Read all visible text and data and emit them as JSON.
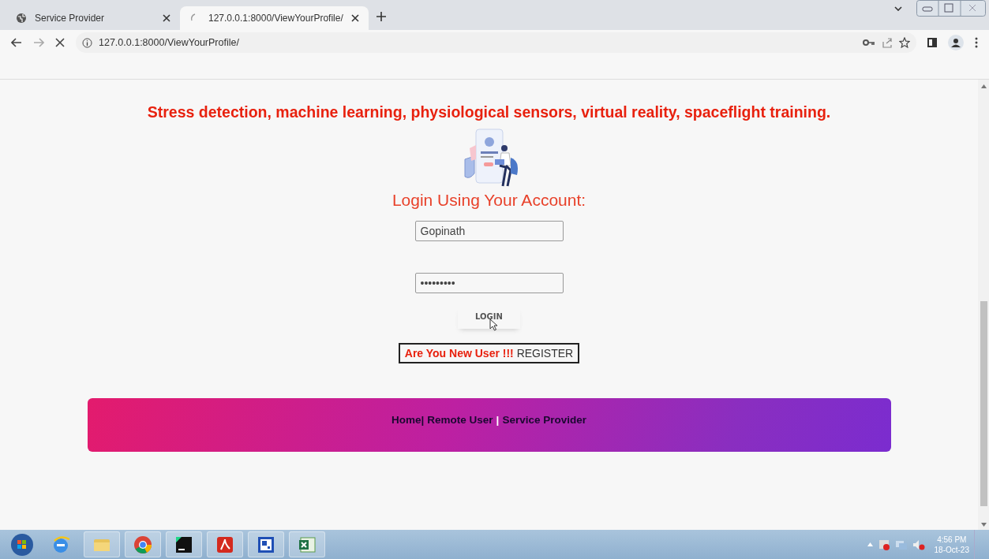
{
  "browser": {
    "tabs": [
      {
        "title": "Service Provider",
        "selected": false,
        "loading": false
      },
      {
        "title": "127.0.0.1:8000/ViewYourProfile/",
        "selected": true,
        "loading": true
      }
    ],
    "address": "127.0.0.1:8000/ViewYourProfile/"
  },
  "page": {
    "heading": "Stress detection, machine learning, physiological sensors, virtual reality, spaceflight training.",
    "login_title": "Login Using Your Account:",
    "username": {
      "value": "Gopinath"
    },
    "password": {
      "value": "•••••••••"
    },
    "login_button": "LOGIN",
    "register": {
      "prompt": "Are You New User !!!",
      "link": "REGISTER"
    },
    "footer_links": [
      {
        "kind": "link",
        "label": "Home|"
      },
      {
        "kind": "link",
        "label": "Remote User"
      },
      {
        "kind": "separator",
        "label": "|"
      },
      {
        "kind": "link",
        "label": "Service Provider"
      }
    ]
  },
  "taskbar": {
    "time": "4:56 PM",
    "date": "18-Oct-23"
  }
}
